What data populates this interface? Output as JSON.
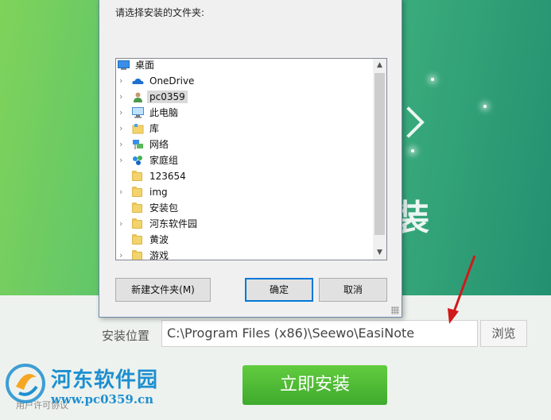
{
  "installer": {
    "location_label": "安装位置",
    "install_path": "C:\\Program Files (x86)\\Seewo\\EasiNote",
    "browse_label": "浏览",
    "install_label": "立即安装",
    "license_text": "用户许可协议",
    "hero_glyph": "装"
  },
  "watermark": {
    "title": "河东软件园",
    "url": "www.pc0359.cn"
  },
  "dialog": {
    "prompt": "请选择安装的文件夹:",
    "tree": [
      {
        "label": "桌面",
        "icon": "desktop-icon",
        "expander": false,
        "indent": 0
      },
      {
        "label": "OneDrive",
        "icon": "onedrive-icon",
        "expander": true,
        "indent": 1
      },
      {
        "label": "pc0359",
        "icon": "user-icon",
        "expander": true,
        "indent": 1,
        "selected": true
      },
      {
        "label": "此电脑",
        "icon": "computer-icon",
        "expander": true,
        "indent": 1
      },
      {
        "label": "库",
        "icon": "library-icon",
        "expander": true,
        "indent": 1
      },
      {
        "label": "网络",
        "icon": "network-icon",
        "expander": true,
        "indent": 1
      },
      {
        "label": "家庭组",
        "icon": "homegroup-icon",
        "expander": true,
        "indent": 1
      },
      {
        "label": "123654",
        "icon": "folder-icon",
        "expander": false,
        "indent": 1
      },
      {
        "label": "img",
        "icon": "folder-icon",
        "expander": true,
        "indent": 1
      },
      {
        "label": "安装包",
        "icon": "folder-icon",
        "expander": false,
        "indent": 1
      },
      {
        "label": "河东软件园",
        "icon": "folder-icon",
        "expander": true,
        "indent": 1
      },
      {
        "label": "黄波",
        "icon": "folder-icon",
        "expander": false,
        "indent": 1
      },
      {
        "label": "游戏",
        "icon": "folder-icon",
        "expander": true,
        "indent": 1
      }
    ],
    "new_folder_label": "新建文件夹(M)",
    "ok_label": "确定",
    "cancel_label": "取消"
  },
  "colors": {
    "accent": "#0078d7",
    "install_green": "#4bb934",
    "watermark_blue": "#1d8fd0",
    "arrow_red": "#d0191b"
  }
}
